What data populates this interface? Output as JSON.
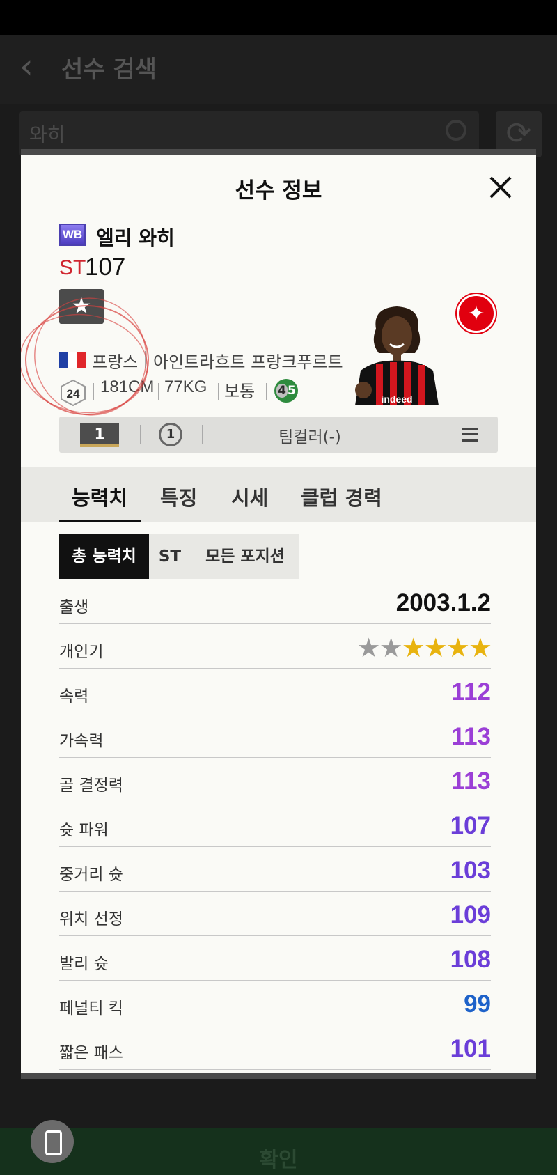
{
  "background": {
    "header_title": "선수 검색",
    "search_value": "와히",
    "confirm_label": "확인"
  },
  "modal": {
    "title": "선수 정보"
  },
  "player": {
    "season_badge": "WB",
    "name": "엘리 와히",
    "position": "ST",
    "ovr": "107",
    "grade_icon": "★",
    "nation": "프랑스",
    "club": "아인트라흐트 프랑크푸르트",
    "age": "24",
    "height": "181CM",
    "weight": "77KG",
    "body_type": "보통",
    "weak_foot": "4",
    "strong_foot": "5"
  },
  "info_bar": {
    "enhancement": "1",
    "salary": "1",
    "team_color": "팀컬러(-)"
  },
  "tabs": [
    "능력치",
    "특징",
    "시세",
    "클럽 경력"
  ],
  "segments": [
    "총 능력치",
    "ST",
    "모든 포지션"
  ],
  "stats": [
    {
      "label": "출생",
      "value": "2003.1.2",
      "color": "#111111"
    },
    {
      "label": "개인기",
      "stars_filled": 4,
      "stars_total": 6
    },
    {
      "label": "속력",
      "value": "112",
      "color": "#9b3fd6"
    },
    {
      "label": "가속력",
      "value": "113",
      "color": "#9b3fd6"
    },
    {
      "label": "골 결정력",
      "value": "113",
      "color": "#9b3fd6"
    },
    {
      "label": "슛 파워",
      "value": "107",
      "color": "#6b3ed8"
    },
    {
      "label": "중거리 슛",
      "value": "103",
      "color": "#6b3ed8"
    },
    {
      "label": "위치 선정",
      "value": "109",
      "color": "#6b3ed8"
    },
    {
      "label": "발리 슛",
      "value": "108",
      "color": "#6b3ed8"
    },
    {
      "label": "페널티 킥",
      "value": "99",
      "color": "#1e62c9"
    },
    {
      "label": "짧은 패스",
      "value": "101",
      "color": "#6b3ed8"
    }
  ],
  "colors": {
    "star_gold": "#e8b30f",
    "star_grey": "#9a9a9a",
    "flag_blue": "#1f3fa5",
    "flag_red": "#e0262b"
  }
}
